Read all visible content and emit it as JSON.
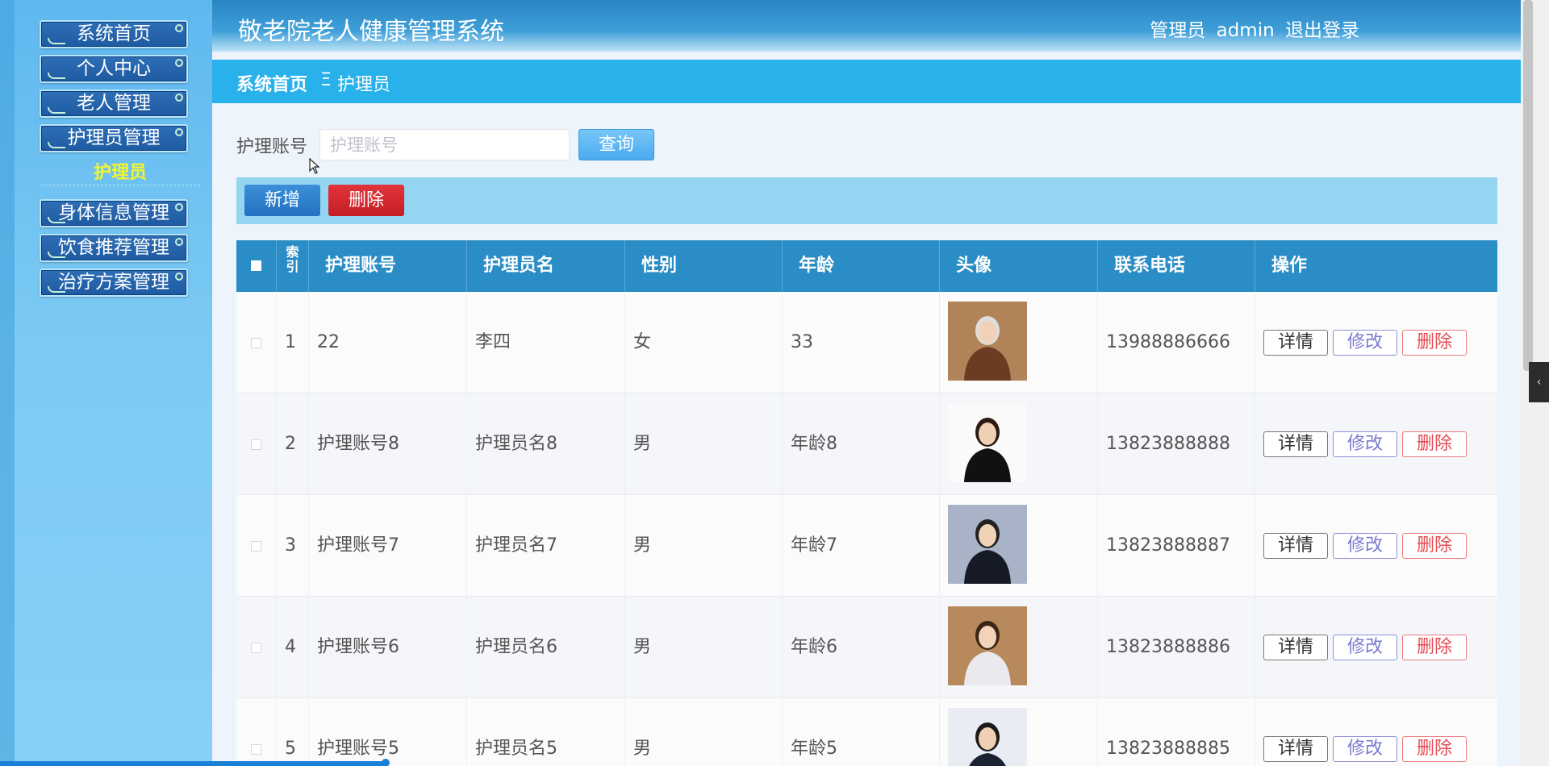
{
  "app": {
    "title": "敬老院老人健康管理系统",
    "user_role": "管理员",
    "user_name": "admin",
    "logout": "退出登录"
  },
  "sidebar": {
    "items": [
      {
        "label": "系统首页"
      },
      {
        "label": "个人中心"
      },
      {
        "label": "老人管理"
      },
      {
        "label": "护理员管理"
      },
      {
        "label": "身体信息管理"
      },
      {
        "label": "饮食推荐管理"
      },
      {
        "label": "治疗方案管理"
      }
    ],
    "active_sub": "护理员"
  },
  "breadcrumb": {
    "home": "系统首页",
    "separator": "Ξ",
    "current": "护理员"
  },
  "search": {
    "label": "护理账号",
    "placeholder": "护理账号",
    "value": "",
    "button": "查询"
  },
  "actions": {
    "add": "新增",
    "delete": "删除"
  },
  "table": {
    "headers": {
      "index": "索引",
      "account": "护理账号",
      "name": "护理员名",
      "gender": "性别",
      "age": "年龄",
      "avatar": "头像",
      "phone": "联系电话",
      "ops": "操作"
    },
    "op_labels": {
      "detail": "详情",
      "edit": "修改",
      "remove": "删除"
    },
    "rows": [
      {
        "index": "1",
        "account": "22",
        "name": "李四",
        "gender": "女",
        "age": "33",
        "phone": "13988886666"
      },
      {
        "index": "2",
        "account": "护理账号8",
        "name": "护理员名8",
        "gender": "男",
        "age": "年龄8",
        "phone": "13823888888"
      },
      {
        "index": "3",
        "account": "护理账号7",
        "name": "护理员名7",
        "gender": "男",
        "age": "年龄7",
        "phone": "13823888887"
      },
      {
        "index": "4",
        "account": "护理账号6",
        "name": "护理员名6",
        "gender": "男",
        "age": "年龄6",
        "phone": "13823888886"
      },
      {
        "index": "5",
        "account": "护理账号5",
        "name": "护理员名5",
        "gender": "男",
        "age": "年龄5",
        "phone": "13823888885"
      }
    ]
  },
  "colors": {
    "header_bg": "#2a86c4",
    "crumb_bg": "#29b1ec",
    "table_head": "#2b8dc6",
    "active_sub": "#f5f52a",
    "delete_btn": "#c41e24"
  }
}
